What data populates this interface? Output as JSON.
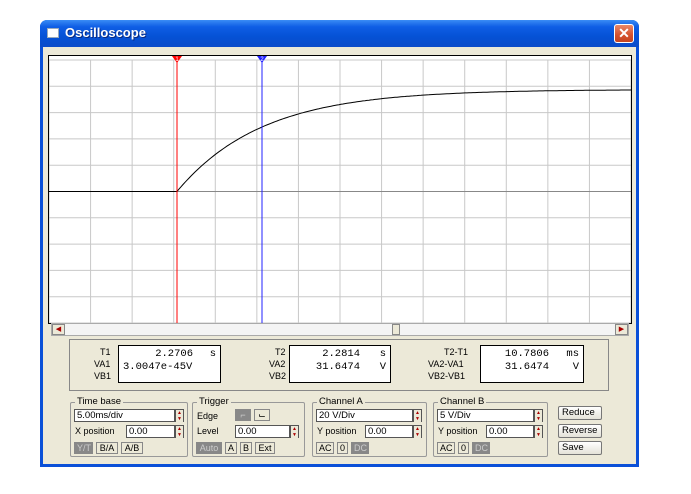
{
  "window": {
    "title": "Oscilloscope",
    "close_glyph": "✕"
  },
  "cursors": {
    "t1_label": "1",
    "t2_label": "2",
    "t1_color": "#ff0000",
    "t2_color": "#2020ff"
  },
  "trace": {
    "color": "#000000",
    "channel": "A"
  },
  "readouts": {
    "t1": {
      "label": "T1",
      "value": "2.2706",
      "unit": "s"
    },
    "va1": {
      "label": "VA1",
      "value": "3.0047e-45",
      "unit": "V"
    },
    "vb1": {
      "label": "VB1",
      "value": "",
      "unit": ""
    },
    "t2": {
      "label": "T2",
      "value": "2.2814",
      "unit": "s"
    },
    "va2": {
      "label": "VA2",
      "value": "31.6474",
      "unit": "V"
    },
    "vb2": {
      "label": "VB2",
      "value": "",
      "unit": ""
    },
    "dt": {
      "label": "T2-T1",
      "value": "10.7806",
      "unit": "ms"
    },
    "dva": {
      "label": "VA2-VA1",
      "value": "31.6474",
      "unit": "V"
    },
    "dvb": {
      "label": "VB2-VB1",
      "value": "",
      "unit": ""
    }
  },
  "timebase": {
    "title": "Time base",
    "value": "5.00ms/div",
    "xpos_label": "X position",
    "xpos_value": "0.00",
    "modes": [
      "Y/T",
      "B/A",
      "A/B"
    ],
    "active_mode": "Y/T"
  },
  "trigger": {
    "title": "Trigger",
    "edge_label": "Edge",
    "level_label": "Level",
    "level_value": "0.00",
    "buttons": [
      "Auto",
      "A",
      "B",
      "Ext"
    ]
  },
  "channel_a": {
    "title": "Channel A",
    "value": "20 V/Div",
    "ypos_label": "Y position",
    "ypos_value": "0.00",
    "coupling": [
      "AC",
      "0",
      "DC"
    ],
    "active": "DC"
  },
  "channel_b": {
    "title": "Channel B",
    "value": "5 V/Div",
    "ypos_label": "Y position",
    "ypos_value": "0.00",
    "coupling": [
      "AC",
      "0",
      "DC"
    ],
    "active": "DC"
  },
  "side_buttons": {
    "reduce": "Reduce",
    "reverse": "Reverse",
    "save": "Save"
  }
}
